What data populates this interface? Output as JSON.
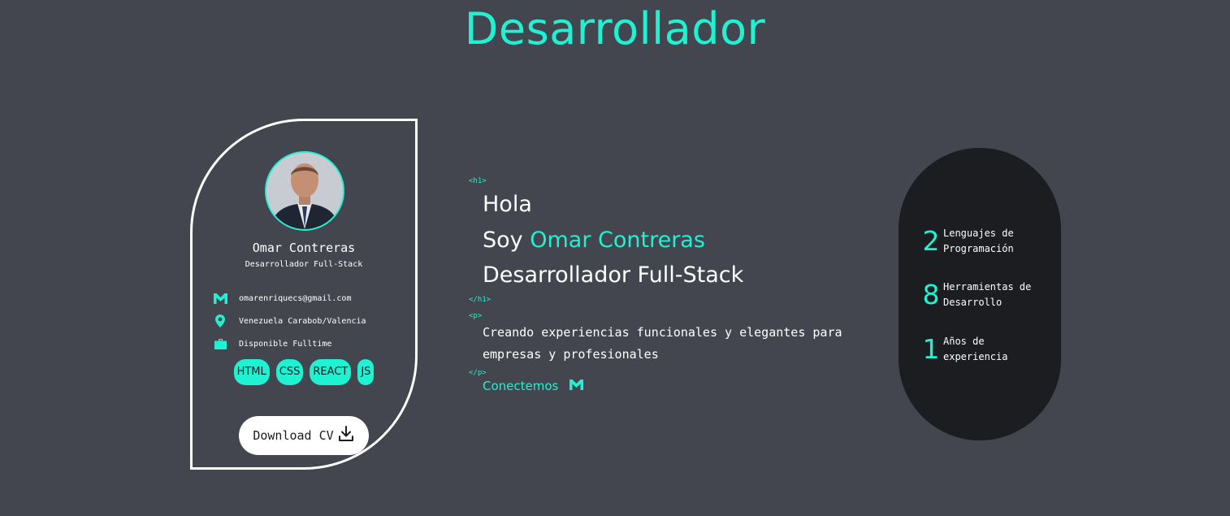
{
  "header": {
    "title": "Desarrollador"
  },
  "profile": {
    "name": "Omar Contreras",
    "role": "Desarrollador Full-Stack",
    "contacts": [
      {
        "icon": "gmail-icon",
        "text": "omarenriquecs@gmail.com"
      },
      {
        "icon": "location-pin-icon",
        "text": "Venezuela Carabob/Valencia"
      },
      {
        "icon": "briefcase-icon",
        "text": "Disponible Fulltime"
      }
    ],
    "skills": [
      "HTML",
      "CSS",
      "REACT",
      "JS"
    ],
    "download_label": "Download CV"
  },
  "intro": {
    "open_h1": "<h1>",
    "greeting": "Hola",
    "soy": "Soy",
    "name": "Omar Contreras",
    "role": "Desarrollador Full-Stack",
    "close_h1": "</h1>",
    "open_p": "<p>",
    "description": "Creando experiencias funcionales y elegantes para empresas y profesionales",
    "close_p": "</p>",
    "connect_label": "Conectemos"
  },
  "stats": [
    {
      "value": "2",
      "label": "Lenguajes de\nProgramación"
    },
    {
      "value": "8",
      "label": "Herramientas de\nDesarrollo"
    },
    {
      "value": "1",
      "label": "Años de\nexperiencia"
    }
  ],
  "colors": {
    "background": "#44464f",
    "accent": "#1ef2d2",
    "dark": "#1b1d21",
    "text": "#ffffff"
  }
}
